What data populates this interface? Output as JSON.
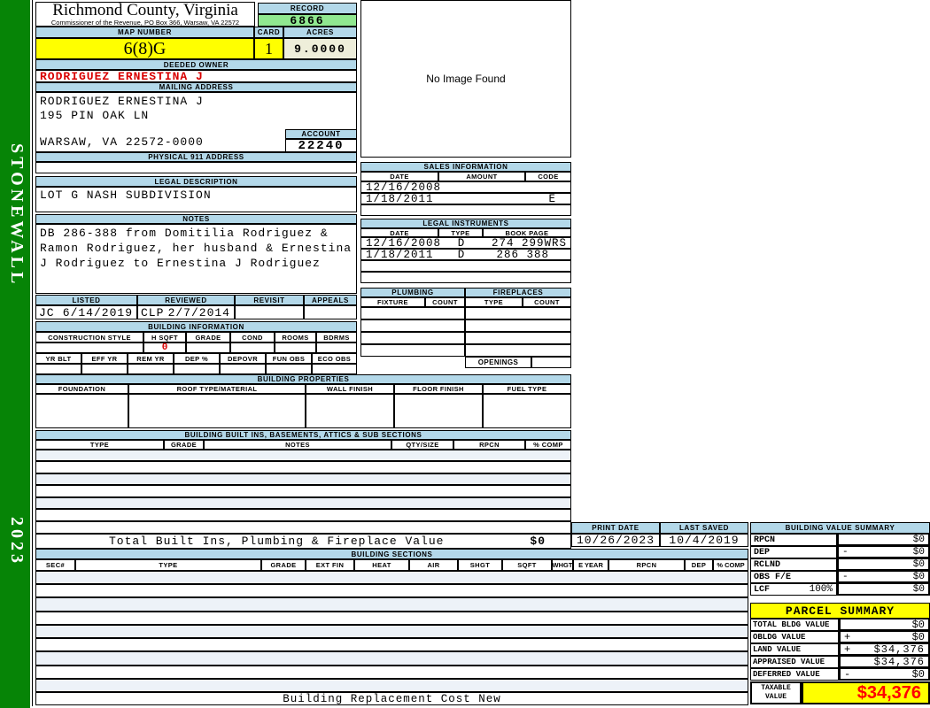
{
  "sidebar": {
    "district": "STONEWALL",
    "year": "2023"
  },
  "header": {
    "county": "Richmond County, Virginia",
    "sub": "Commissioner of the Revenue,  PO Box 366, Warsaw, VA 22572",
    "record_label": "RECORD",
    "record": "6866",
    "map_label": "MAP NUMBER",
    "map": "6(8)G",
    "card_label": "CARD",
    "card": "1",
    "acres_label": "ACRES",
    "acres": "9.0000"
  },
  "owner": {
    "deeded_label": "DEEDED OWNER",
    "name": "RODRIGUEZ ERNESTINA J",
    "mailing_label": "MAILING ADDRESS",
    "mail1": "RODRIGUEZ ERNESTINA J",
    "mail2": "195 PIN OAK LN",
    "mail3": "WARSAW, VA 22572-0000",
    "account_label": "ACCOUNT",
    "account": "22240",
    "physical_label": "PHYSICAL 911 ADDRESS"
  },
  "legal": {
    "label": "LEGAL DESCRIPTION",
    "text": "LOT G NASH SUBDIVISION",
    "notes_label": "NOTES",
    "notes1": "DB 286-388 from Domitilia Rodriguez &",
    "notes2": "Ramon Rodriguez, her husband & Ernestina",
    "notes3": "J Rodriguez to Ernestina J Rodriguez"
  },
  "review": {
    "listed_label": "LISTED",
    "listed_by": "JC",
    "listed_date": "6/14/2019",
    "reviewed_label": "REVIEWED",
    "reviewed_by": "CLP",
    "reviewed_date": "2/7/2014",
    "revisit_label": "REVISIT",
    "appeals_label": "APPEALS"
  },
  "building_info": {
    "title": "BUILDING INFORMATION",
    "h1": [
      "CONSTRUCTION STYLE",
      "H SQFT",
      "GRADE",
      "COND",
      "ROOMS",
      "BDRMS"
    ],
    "hsqft_value": "0",
    "h2": [
      "YR BLT",
      "EFF YR",
      "REM YR",
      "DEP %",
      "DEPOVR",
      "FUN OBS",
      "ECO OBS"
    ]
  },
  "image_box": {
    "text": "No Image Found"
  },
  "sales": {
    "title": "SALES INFORMATION",
    "headers": [
      "DATE",
      "AMOUNT",
      "CODE"
    ],
    "rows": [
      {
        "date": "12/16/2008",
        "amount": "",
        "code": ""
      },
      {
        "date": "1/18/2011",
        "amount": "",
        "code": "E"
      }
    ]
  },
  "instruments": {
    "title": "LEGAL INSTRUMENTS",
    "headers": [
      "DATE",
      "TYPE",
      "BOOK PAGE"
    ],
    "rows": [
      {
        "date": "12/16/2008",
        "type": "D",
        "book": "274 299WRS"
      },
      {
        "date": "1/18/2011",
        "type": "D",
        "book": "286 388"
      }
    ]
  },
  "plumbing": {
    "title": "PLUMBING",
    "headers": [
      "FIXTURE",
      "COUNT"
    ]
  },
  "fireplaces": {
    "title": "FIREPLACES",
    "headers": [
      "TYPE",
      "COUNT"
    ],
    "openings_label": "OPENINGS"
  },
  "properties": {
    "title": "BUILDING PROPERTIES",
    "headers": [
      "FOUNDATION",
      "ROOF TYPE/MATERIAL",
      "WALL FINISH",
      "FLOOR FINISH",
      "FUEL TYPE"
    ]
  },
  "builtins": {
    "title": "BUILDING BUILT INS, BASEMENTS, ATTICS & SUB SECTIONS",
    "headers": [
      "TYPE",
      "GRADE",
      "NOTES",
      "QTY/SIZE",
      "RPCN",
      "% COMP"
    ],
    "total_label": "Total Built Ins, Plumbing & Fireplace Value",
    "total_value": "$0"
  },
  "sections": {
    "title": "BUILDING SECTIONS",
    "headers": [
      "SEC#",
      "TYPE",
      "GRADE",
      "EXT FIN",
      "HEAT",
      "AIR",
      "SHGT",
      "SQFT",
      "WHGT",
      "E YEAR",
      "RPCN",
      "DEP",
      "% COMP"
    ],
    "footer": "Building Replacement Cost New"
  },
  "dates": {
    "print_label": "PRINT DATE",
    "print": "10/26/2023",
    "saved_label": "LAST SAVED",
    "saved": "10/4/2019"
  },
  "bvs": {
    "title": "BUILDING VALUE SUMMARY",
    "rows": [
      {
        "label": "RPCN",
        "op": "",
        "value": "$0"
      },
      {
        "label": "DEP",
        "op": "-",
        "value": "$0"
      },
      {
        "label": "RCLND",
        "op": "",
        "value": "$0"
      },
      {
        "label": "OBS F/E",
        "op": "-",
        "value": "$0"
      }
    ],
    "lcf_label": "LCF",
    "lcf_pct": "100%",
    "lcf_value": "$0"
  },
  "parcel": {
    "title": "PARCEL SUMMARY",
    "rows": [
      {
        "label": "TOTAL BLDG VALUE",
        "op": "",
        "value": "$0"
      },
      {
        "label": "OBLDG VALUE",
        "op": "+",
        "value": "$0"
      },
      {
        "label": "LAND VALUE",
        "op": "+",
        "value": "$34,376"
      },
      {
        "label": "APPRAISED VALUE",
        "op": "",
        "value": "$34,376"
      },
      {
        "label": "DEFERRED VALUE",
        "op": "-",
        "value": "$0"
      }
    ],
    "taxable_label1": "TAXABLE",
    "taxable_label2": "VALUE",
    "taxable_value": "$34,376"
  },
  "colors": {
    "sidebar_green": "#068406",
    "header_blue": "#b3d8e9",
    "highlight_yellow": "#ffff00",
    "record_green": "#90e890",
    "acres_cream": "#eeeeda",
    "owner_red": "#d80000",
    "taxable_red": "#ff0000"
  }
}
